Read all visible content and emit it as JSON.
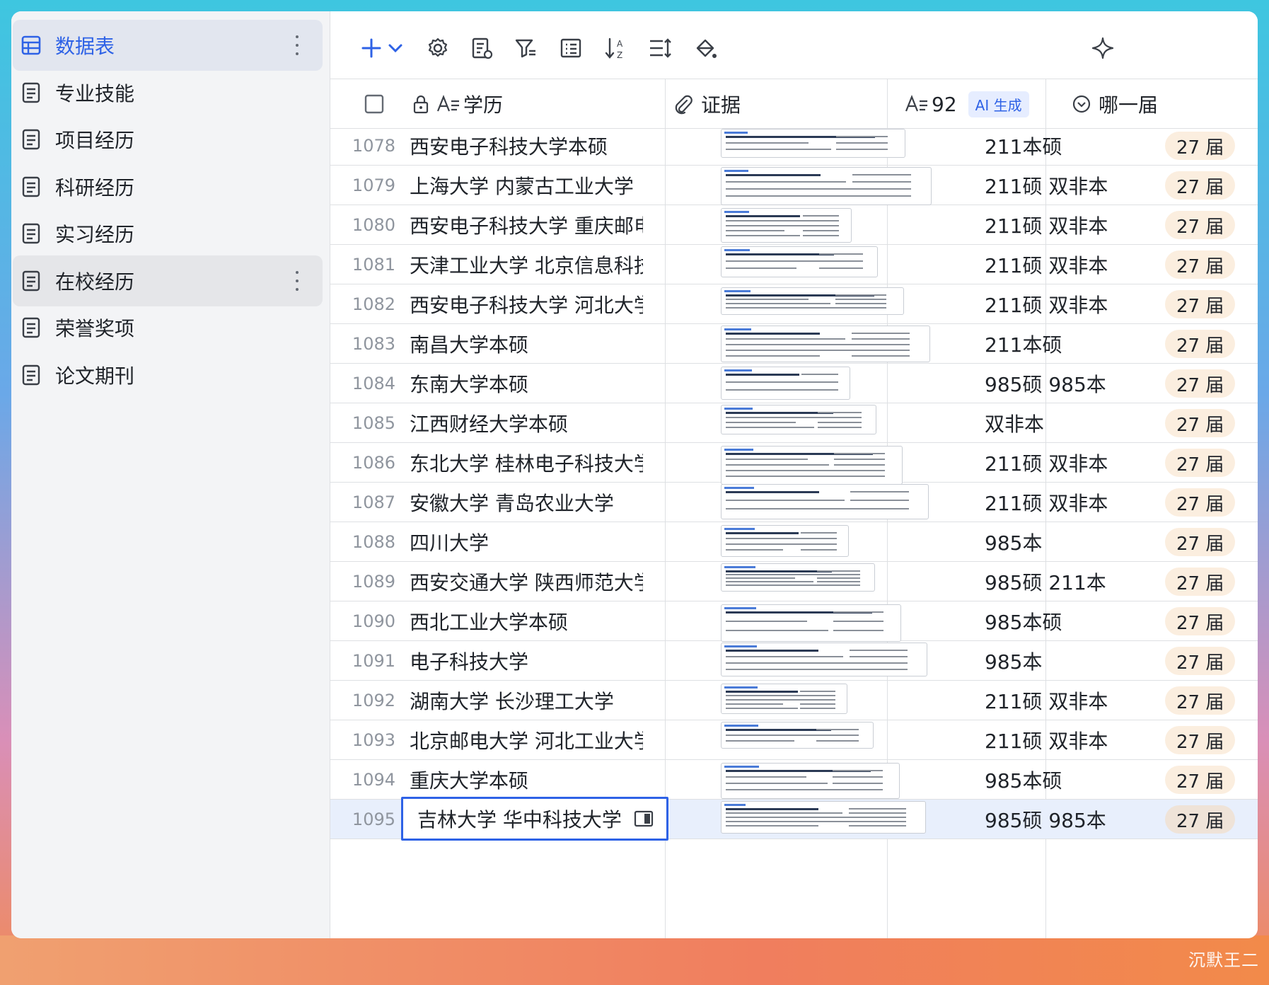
{
  "sidebar": {
    "items": [
      {
        "label": "数据表",
        "icon": "table-icon",
        "state": "active"
      },
      {
        "label": "专业技能",
        "icon": "document-icon",
        "state": ""
      },
      {
        "label": "项目经历",
        "icon": "document-icon",
        "state": ""
      },
      {
        "label": "科研经历",
        "icon": "document-icon",
        "state": ""
      },
      {
        "label": "实习经历",
        "icon": "document-icon",
        "state": ""
      },
      {
        "label": "在校经历",
        "icon": "document-icon",
        "state": "hover"
      },
      {
        "label": "荣誉奖项",
        "icon": "document-icon",
        "state": ""
      },
      {
        "label": "论文期刊",
        "icon": "document-icon",
        "state": ""
      }
    ]
  },
  "toolbar": {
    "icons": [
      "add-icon",
      "chevron-down-icon",
      "settings-icon",
      "form-icon",
      "filter-icon",
      "group-icon",
      "sort-icon",
      "row-height-icon",
      "fill-color-icon",
      "ai-sparkle-icon"
    ]
  },
  "columns": {
    "education": "学历",
    "evidence": "证据",
    "tag": "92",
    "tag_badge": "AI 生成",
    "year": "哪一届"
  },
  "colors": {
    "accent": "#2e62e6",
    "year_tag_bg": "#fbeedf",
    "ai_badge_bg": "#e6edff"
  },
  "rows": [
    {
      "num": "1078",
      "edu": "西安电子科技大学本硕",
      "tag": "211本硕",
      "year": "27 届"
    },
    {
      "num": "1079",
      "edu": "上海大学 内蒙古工业大学",
      "tag": "211硕 双非本",
      "year": "27 届"
    },
    {
      "num": "1080",
      "edu": "西安电子科技大学 重庆邮电...",
      "tag": "211硕 双非本",
      "year": "27 届"
    },
    {
      "num": "1081",
      "edu": "天津工业大学 北京信息科技...",
      "tag": "211硕 双非本",
      "year": "27 届"
    },
    {
      "num": "1082",
      "edu": "西安电子科技大学 河北大学",
      "tag": "211硕 双非本",
      "year": "27 届"
    },
    {
      "num": "1083",
      "edu": "南昌大学本硕",
      "tag": "211本硕",
      "year": "27 届"
    },
    {
      "num": "1084",
      "edu": "东南大学本硕",
      "tag": "985硕 985本",
      "year": "27 届"
    },
    {
      "num": "1085",
      "edu": "江西财经大学本硕",
      "tag": "双非本",
      "year": "27 届"
    },
    {
      "num": "1086",
      "edu": "东北大学 桂林电子科技大学",
      "tag": "211硕 双非本",
      "year": "27 届"
    },
    {
      "num": "1087",
      "edu": "安徽大学 青岛农业大学",
      "tag": "211硕 双非本",
      "year": "27 届"
    },
    {
      "num": "1088",
      "edu": "四川大学",
      "tag": "985本",
      "year": "27 届"
    },
    {
      "num": "1089",
      "edu": "西安交通大学 陕西师范大学",
      "tag": "985硕 211本",
      "year": "27 届"
    },
    {
      "num": "1090",
      "edu": "西北工业大学本硕",
      "tag": "985本硕",
      "year": "27 届"
    },
    {
      "num": "1091",
      "edu": "电子科技大学",
      "tag": "985本",
      "year": "27 届"
    },
    {
      "num": "1092",
      "edu": "湖南大学 长沙理工大学",
      "tag": "211硕 双非本",
      "year": "27 届"
    },
    {
      "num": "1093",
      "edu": "北京邮电大学 河北工业大学",
      "tag": "211硕 双非本",
      "year": "27 届"
    },
    {
      "num": "1094",
      "edu": "重庆大学本硕",
      "tag": "985本硕",
      "year": "27 届"
    },
    {
      "num": "1095",
      "edu": "吉林大学 华中科技大学",
      "tag": "985硕 985本",
      "year": "27 届"
    }
  ],
  "watermark": "沉默王二"
}
